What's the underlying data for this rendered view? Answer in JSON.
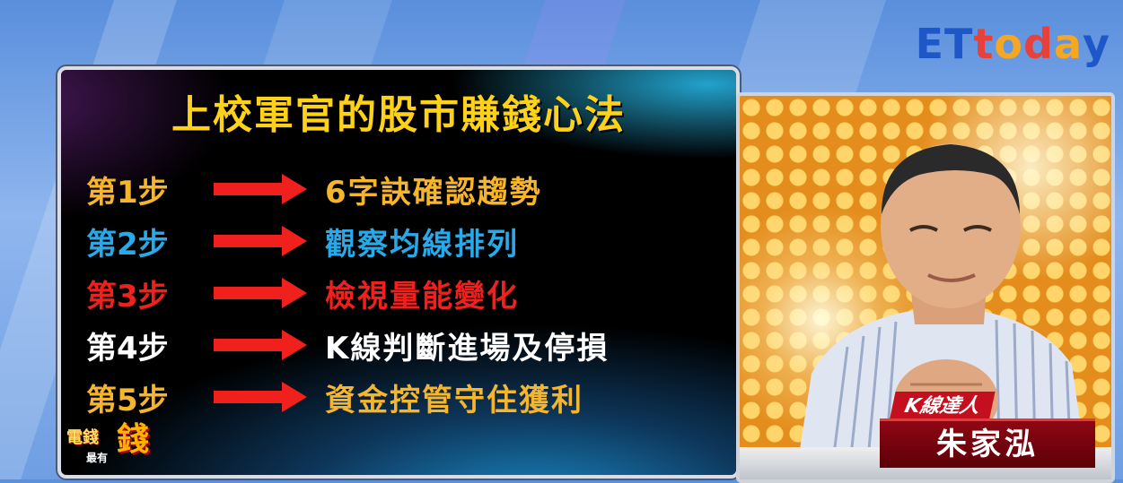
{
  "logo": {
    "letters": [
      "E",
      "T",
      "t",
      "o",
      "d",
      "a",
      "y"
    ]
  },
  "board": {
    "title": "上校軍官的股市賺錢心法",
    "steps": [
      {
        "label": "第1步",
        "text": "6字訣確認趨勢",
        "color": "#f5b52c"
      },
      {
        "label": "第2步",
        "text": "觀察均線排列",
        "color": "#29a9e8"
      },
      {
        "label": "第3步",
        "text": "檢視量能變化",
        "color": "#f0201c"
      },
      {
        "label": "第4步",
        "text": "K線判斷進場及停損",
        "color": "#ffffff"
      },
      {
        "label": "第5步",
        "text": "資金控管守住獲利",
        "color": "#f5b52c"
      }
    ],
    "arrow_icon": "right-arrow-icon",
    "show_logo": {
      "line1": "電錢",
      "line2": "最有",
      "line3": "錢"
    }
  },
  "guest": {
    "title": "K線達人",
    "name": "朱家泓"
  },
  "colors": {
    "arrow": "#f0201c",
    "title": "#ffd21a",
    "nameplate": "#c40f1f"
  }
}
